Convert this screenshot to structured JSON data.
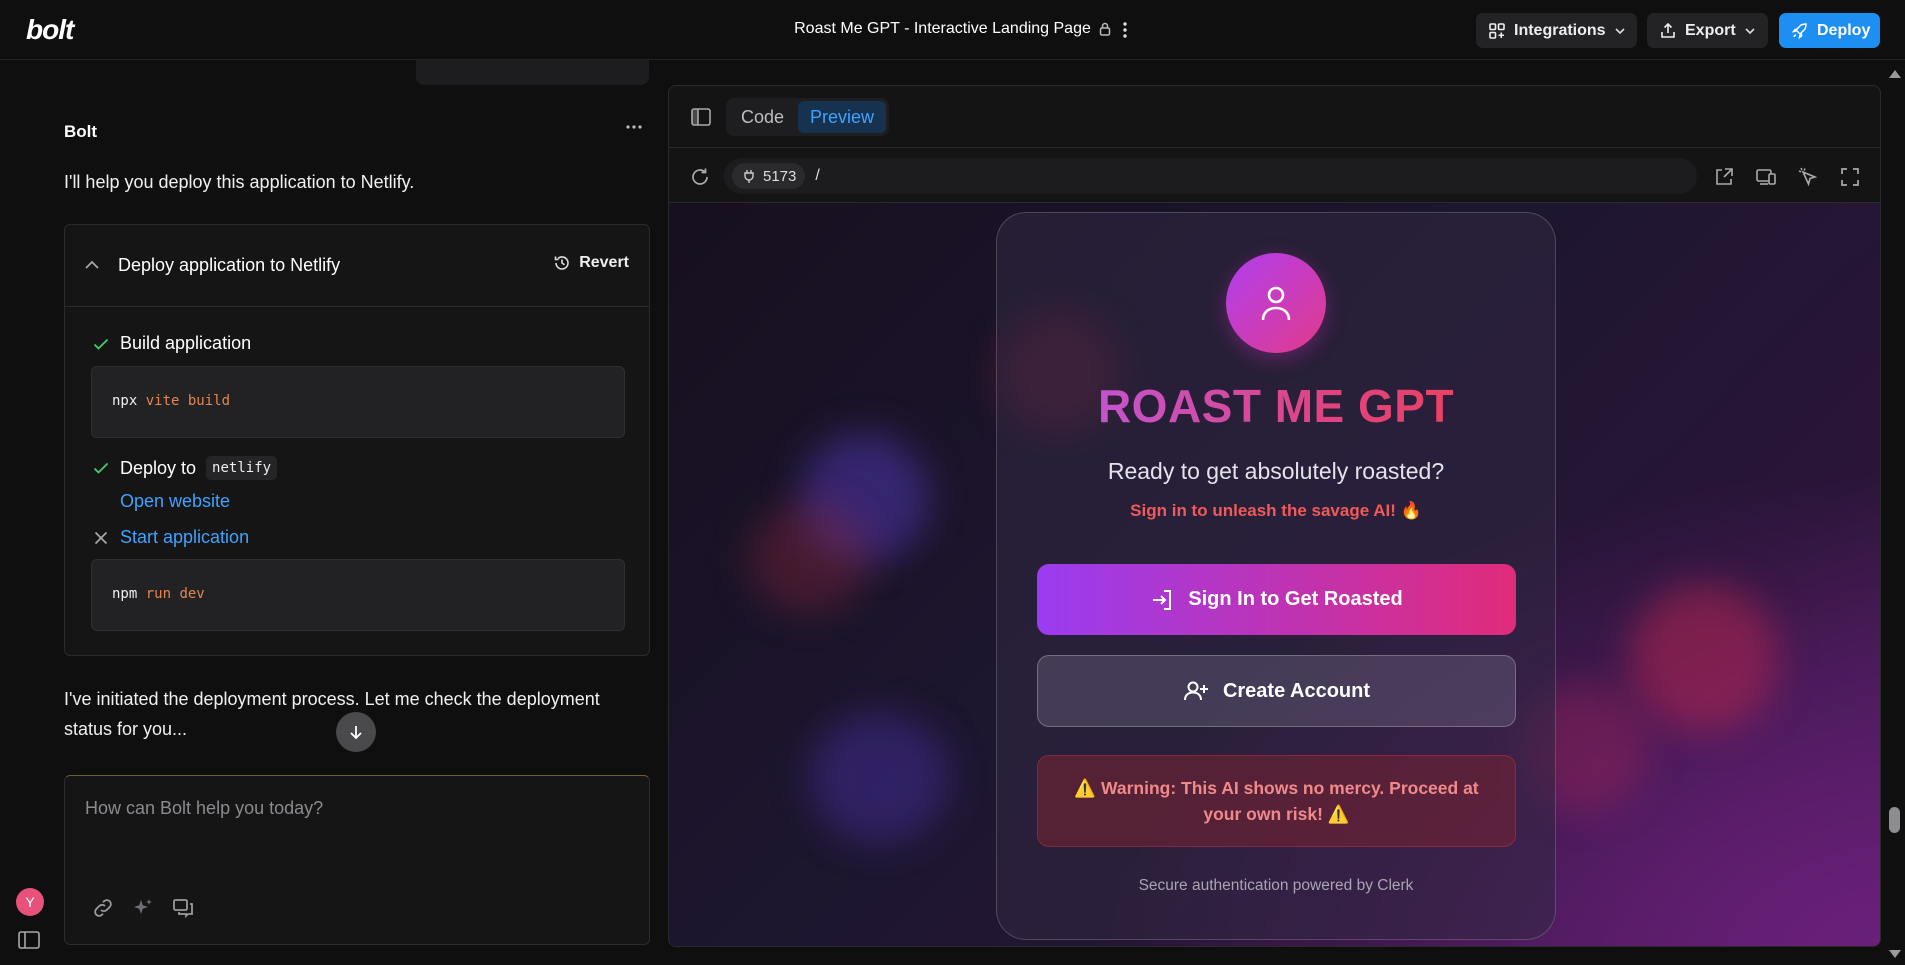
{
  "header": {
    "logo": "bolt",
    "project_title": "Roast Me GPT - Interactive Landing Page",
    "integrations_label": "Integrations",
    "export_label": "Export",
    "deploy_label": "Deploy"
  },
  "chat": {
    "assistant_name": "Bolt",
    "message_1": "I'll help you deploy this application to Netlify.",
    "action": {
      "title": "Deploy application to Netlify",
      "revert_label": "Revert",
      "steps": [
        {
          "label": "Build application",
          "status": "done",
          "command_bin": "npx",
          "command_args": "vite build"
        },
        {
          "label": "Deploy to",
          "target": "netlify",
          "status": "done",
          "link_label": "Open website"
        },
        {
          "label": "Start application",
          "status": "cancelled",
          "command_bin": "npm",
          "command_args": "run dev"
        }
      ]
    },
    "message_2": "I've initiated the deployment process. Let me check the deployment status for you...",
    "input_placeholder": "How can Bolt help you today?",
    "user_initial": "Y"
  },
  "workbench": {
    "tabs": [
      {
        "label": "Code",
        "active": false
      },
      {
        "label": "Preview",
        "active": true
      }
    ],
    "port": "5173",
    "path": "/"
  },
  "preview": {
    "title": "ROAST ME GPT",
    "subtitle": "Ready to get absolutely roasted?",
    "cta_text": "Sign in to unleash the savage AI! 🔥",
    "signin_label": "Sign In to Get Roasted",
    "create_label": "Create Account",
    "warning_text": "⚠️ Warning: This AI shows no mercy. Proceed at your own risk! ⚠️",
    "footer": "Secure authentication powered by Clerk"
  },
  "colors": {
    "accent_blue": "#1d8ef2",
    "success_green": "#3ecf6a",
    "preview_gradient_start": "#9a3cf0",
    "preview_gradient_end": "#e02b7a"
  }
}
